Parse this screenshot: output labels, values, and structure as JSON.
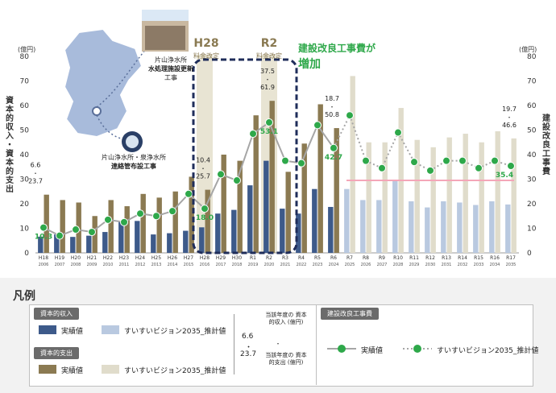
{
  "chart_data": {
    "type": "bar+line",
    "categories": [
      {
        "era": "H18",
        "year": "2006"
      },
      {
        "era": "H19",
        "year": "2007"
      },
      {
        "era": "H20",
        "year": "2008"
      },
      {
        "era": "H21",
        "year": "2009"
      },
      {
        "era": "H22",
        "year": "2010"
      },
      {
        "era": "H23",
        "year": "2011"
      },
      {
        "era": "H24",
        "year": "2012"
      },
      {
        "era": "H25",
        "year": "2013"
      },
      {
        "era": "H26",
        "year": "2014"
      },
      {
        "era": "H27",
        "year": "2015"
      },
      {
        "era": "H28",
        "year": "2016"
      },
      {
        "era": "H29",
        "year": "2017"
      },
      {
        "era": "H30",
        "year": "2018"
      },
      {
        "era": "R1",
        "year": "2019"
      },
      {
        "era": "R2",
        "year": "2020"
      },
      {
        "era": "R3",
        "year": "2021"
      },
      {
        "era": "R4",
        "year": "2022"
      },
      {
        "era": "R5",
        "year": "2023"
      },
      {
        "era": "R6",
        "year": "2024"
      },
      {
        "era": "R7",
        "year": "2025"
      },
      {
        "era": "R8",
        "year": "2026"
      },
      {
        "era": "R9",
        "year": "2027"
      },
      {
        "era": "R10",
        "year": "2028"
      },
      {
        "era": "R11",
        "year": "2029"
      },
      {
        "era": "R12",
        "year": "2030"
      },
      {
        "era": "R13",
        "year": "2031"
      },
      {
        "era": "R14",
        "year": "2032"
      },
      {
        "era": "R15",
        "year": "2033"
      },
      {
        "era": "R16",
        "year": "2034"
      },
      {
        "era": "R17",
        "year": "2035"
      }
    ],
    "actual_count": 19,
    "series": [
      {
        "name": "資本的収入",
        "axis": "left",
        "values": [
          6.6,
          7.5,
          6.5,
          7.0,
          8.5,
          12.5,
          13.0,
          7.5,
          8.0,
          9.0,
          10.4,
          16.0,
          17.5,
          27.5,
          37.5,
          18.0,
          16.0,
          26.0,
          18.7,
          26.0,
          21.5,
          21.5,
          29.5,
          21.0,
          18.5,
          21.0,
          20.5,
          19.5,
          21.0,
          19.7
        ]
      },
      {
        "name": "資本的支出",
        "axis": "left",
        "values": [
          23.7,
          21.5,
          20.5,
          15.0,
          21.5,
          19.0,
          24.0,
          22.5,
          25.0,
          31.0,
          25.7,
          40.0,
          37.5,
          56.0,
          61.9,
          33.0,
          44.5,
          60.5,
          50.8,
          72.0,
          45.0,
          45.0,
          59.0,
          46.0,
          43.0,
          47.0,
          48.5,
          45.0,
          49.5,
          46.6
        ]
      },
      {
        "name": "建設改良工事費",
        "axis": "right",
        "values": [
          10.3,
          7.0,
          9.5,
          8.5,
          13.5,
          12.5,
          16.0,
          15.0,
          17.0,
          24.0,
          18.0,
          32.0,
          29.5,
          48.5,
          53.1,
          37.5,
          36.5,
          52.0,
          42.7,
          56.0,
          37.5,
          34.5,
          49.0,
          37.0,
          33.5,
          37.5,
          37.5,
          34.5,
          37.5,
          35.4
        ]
      }
    ],
    "point_labels": [
      {
        "index": 0,
        "income": "6.6",
        "expense": "23.7",
        "line": "10.3"
      },
      {
        "index": 10,
        "income": "10.4",
        "expense": "25.7",
        "line": "18.0"
      },
      {
        "index": 14,
        "income": "37.5",
        "expense": "61.9",
        "line": "53.1"
      },
      {
        "index": 18,
        "income": "18.7",
        "expense": "50.8",
        "line": "42.7"
      },
      {
        "index": 29,
        "income": "19.7",
        "expense": "46.6",
        "line": "35.4"
      }
    ],
    "dot_sep": "・",
    "left_axis": {
      "unit": "(億円)",
      "label": "資本的収入・資本的支出",
      "ylim": [
        0,
        80
      ],
      "ticks": [
        0,
        10,
        20,
        30,
        40,
        50,
        60,
        70,
        80
      ]
    },
    "right_axis": {
      "unit": "(億円)",
      "label": "建設改良工事費",
      "ylim": [
        0,
        80
      ],
      "ticks": [
        0,
        10,
        20,
        30,
        40,
        50,
        60,
        70,
        80
      ]
    },
    "reference_line": {
      "value": 29.5,
      "from_index": 19,
      "to_index": 29,
      "color": "#f4a6b8"
    },
    "colors": {
      "income_actual": "#3d5a8a",
      "income_plan": "#b9c9e0",
      "expense_actual": "#8b7a52",
      "expense_plan": "#e0dccb",
      "line": "#2ea84a",
      "line_text": "#2ea84a",
      "highlight": "#e8e4d3",
      "dashed_box": "#1f2d5a",
      "callout_green": "#2ea84a",
      "callout_tan": "#8a7a52"
    },
    "annotations": {
      "h28_title": "H28",
      "h28_sub": "料金改定",
      "r2_title": "R2",
      "r2_sub": "料金改定",
      "callout_line1": "建設改良工事費が",
      "callout_line2": "増加",
      "map_label1_line1": "片山浄水所",
      "map_label1_line2": "水処理施設更新",
      "map_label1_line3": "工事",
      "map_label2_line1": "片山浄水所・泉浄水所",
      "map_label2_line2": "連絡管布設工事"
    }
  },
  "legend": {
    "title": "凡例",
    "income_tag": "資本的収入",
    "expense_tag": "資本的支出",
    "actual": "実績値",
    "plan": "すいすいビジョン2035_推計値",
    "sample_top": "6.6",
    "sample_dot": "・",
    "sample_bottom": "23.7",
    "note_income": "当該年度の 資本的収入 (億円)",
    "note_expense": "当該年度の 資本的支出 (億円)",
    "construction_tag": "建設改良工事費",
    "line_actual": "実績値",
    "line_plan": "すいすいビジョン2035_推計値"
  }
}
